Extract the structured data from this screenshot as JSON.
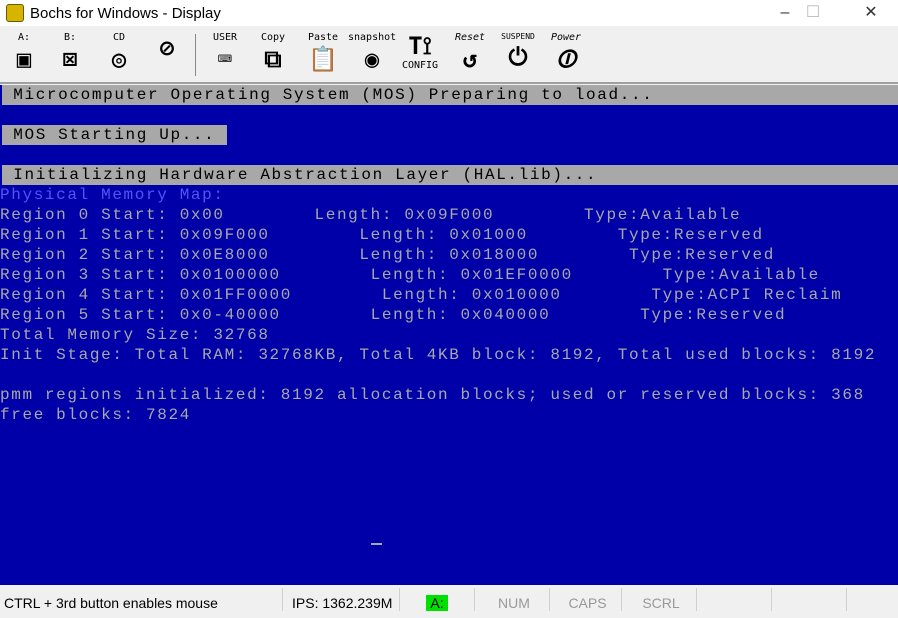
{
  "window": {
    "title": "Bochs for Windows - Display",
    "controls": [
      "–",
      "☐",
      "✕"
    ]
  },
  "toolbar": {
    "items": [
      {
        "label": "A:",
        "icon": "floppy-a-icon",
        "glyph": "▣"
      },
      {
        "label": "B:",
        "icon": "floppy-b-icon",
        "glyph": "⊠"
      },
      {
        "label": "CD",
        "icon": "cdrom-icon",
        "glyph": "◎"
      },
      {
        "label": "",
        "icon": "mouse-icon",
        "glyph": "⊘"
      },
      {
        "label": "USER",
        "icon": "keyboard-icon",
        "glyph": "⌨"
      },
      {
        "label": "Copy",
        "icon": "copy-icon",
        "glyph": "⧉"
      },
      {
        "label": "Paste",
        "icon": "paste-icon",
        "glyph": "📋"
      },
      {
        "label": "snapshot",
        "icon": "camera-icon",
        "glyph": "◉"
      },
      {
        "label": "CONFIG",
        "icon": "config-icon",
        "glyph": "T⟟"
      },
      {
        "label": "Reset",
        "icon": "reset-icon",
        "glyph": "↺"
      },
      {
        "label": "SUSPEND",
        "icon": "suspend-icon",
        "glyph": "⏻"
      },
      {
        "label": "Power",
        "icon": "power-icon",
        "glyph": "⏼"
      }
    ]
  },
  "screen": {
    "line0": " Microcomputer Operating System (MOS) Preparing to load...",
    "line2": " MOS Starting Up... ",
    "line4": " Initializing Hardware Abstraction Layer (HAL.lib)...",
    "line5": "Physical Memory Map:",
    "line6": "Region 0 Start: 0x00        Length: 0x09F000        Type:Available",
    "line7": "Region 1 Start: 0x09F000        Length: 0x01000        Type:Reserved",
    "line8": "Region 2 Start: 0x0E8000        Length: 0x018000        Type:Reserved",
    "line9": "Region 3 Start: 0x0100000        Length: 0x01EF0000        Type:Available",
    "line10": "Region 4 Start: 0x01FF0000        Length: 0x010000        Type:ACPI Reclaim",
    "line11": "Region 5 Start: 0x0-40000        Length: 0x040000        Type:Reserved",
    "line12": "Total Memory Size: 32768",
    "line13": "Init Stage: Total RAM: 32768KB, Total 4KB block: 8192, Total used blocks: 8192",
    "line15": "pmm regions initialized: 8192 allocation blocks; used or reserved blocks: 368",
    "line16": "free blocks: 7824",
    "colors": {
      "background": "#0000a8",
      "text": "#a8a8a8",
      "highlight": "#5454fc"
    }
  },
  "status": {
    "hint": "CTRL + 3rd button enables mouse",
    "ips": "IPS: 1362.239M",
    "drive": "A:",
    "num": "NUM",
    "caps": "CAPS",
    "scrl": "SCRL"
  }
}
